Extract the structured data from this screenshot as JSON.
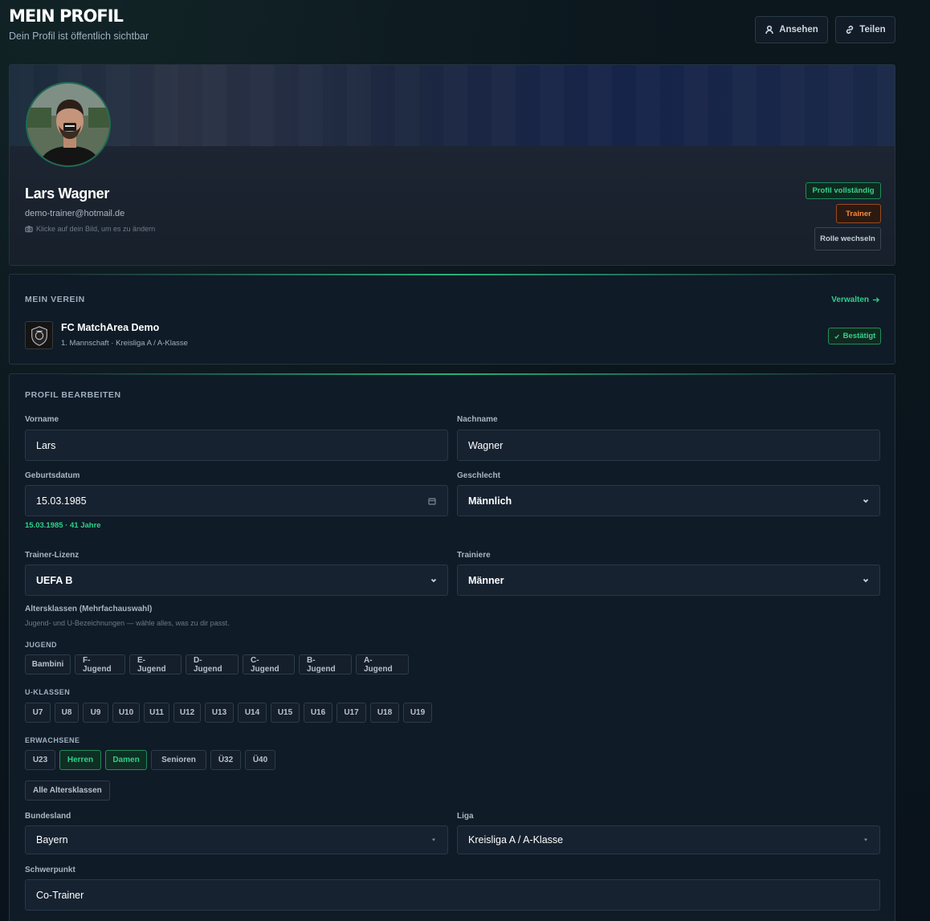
{
  "header": {
    "title": "MEIN PROFIL",
    "subtitle": "Dein Profil ist öffentlich sichtbar",
    "view_label": "Ansehen",
    "share_label": "Teilen"
  },
  "profile": {
    "name": "Lars Wagner",
    "email": "demo-trainer@hotmail.de",
    "photo_hint": "Klicke auf dein Bild, um es zu ändern",
    "complete_badge": "Profil vollständig",
    "role_badge": "Trainer",
    "switch_role": "Rolle wechseln"
  },
  "club": {
    "section_label": "MEIN VEREIN",
    "manage_label": "Verwalten",
    "name": "FC MatchArea Demo",
    "details": "1. Mannschaft · Kreisliga A / A-Klasse",
    "status": "Bestätigt"
  },
  "edit": {
    "section_label": "PROFIL BEARBEITEN",
    "firstname": {
      "label": "Vorname",
      "value": "Lars"
    },
    "lastname": {
      "label": "Nachname",
      "value": "Wagner"
    },
    "birthdate": {
      "label": "Geburtsdatum",
      "value": "15.03.1985",
      "note": "15.03.1985 · 41 Jahre"
    },
    "gender": {
      "label": "Geschlecht",
      "value": "Männlich"
    },
    "license": {
      "label": "Trainer-Lizenz",
      "value": "UEFA B"
    },
    "coaches": {
      "label": "Trainiere",
      "value": "Männer"
    },
    "age_classes": {
      "label": "Altersklassen (Mehrfachauswahl)",
      "hint": "Jugend- und U-Bezeichnungen — wähle alles, was zu dir passt.",
      "youth_label": "JUGEND",
      "youth": [
        "Bambini",
        "F-Jugend",
        "E-Jugend",
        "D-Jugend",
        "C-Jugend",
        "B-Jugend",
        "A-Jugend"
      ],
      "u_label": "U-KLASSEN",
      "u": [
        "U7",
        "U8",
        "U9",
        "U10",
        "U11",
        "U12",
        "U13",
        "U14",
        "U15",
        "U16",
        "U17",
        "U18",
        "U19"
      ],
      "adult_label": "ERWACHSENE",
      "adult": [
        {
          "label": "U23",
          "selected": false
        },
        {
          "label": "Herren",
          "selected": true
        },
        {
          "label": "Damen",
          "selected": true
        },
        {
          "label": "Senioren",
          "selected": false
        },
        {
          "label": "Ü32",
          "selected": false
        },
        {
          "label": "Ü40",
          "selected": false
        }
      ],
      "all_label": "Alle Altersklassen"
    },
    "state": {
      "label": "Bundesland",
      "value": "Bayern"
    },
    "league": {
      "label": "Liga",
      "value": "Kreisliga A / A-Klasse"
    },
    "focus": {
      "label": "Schwerpunkt",
      "value": "Co-Trainer"
    }
  },
  "colors": {
    "accent": "#2ed18a",
    "orange": "#ff8a3d",
    "background": "#0b141c",
    "card": "#0f1b27"
  }
}
